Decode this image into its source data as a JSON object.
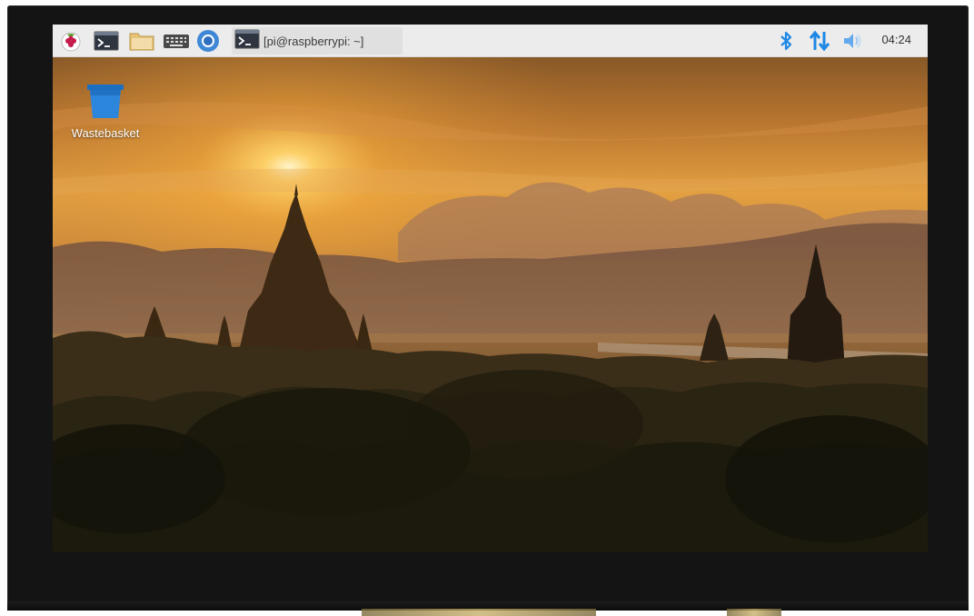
{
  "taskbar": {
    "launchers": [
      {
        "icon": "raspberry-menu-icon"
      },
      {
        "icon": "terminal-icon"
      },
      {
        "icon": "folder-icon"
      },
      {
        "icon": "keyboard-icon"
      },
      {
        "icon": "chromium-icon"
      }
    ],
    "window_task": {
      "icon": "terminal-icon",
      "label": "[pi@raspberrypi: ~]"
    },
    "tray": {
      "bluetooth_icon": "bluetooth-icon",
      "network_icon": "network-arrows-icon",
      "volume_icon": "volume-icon",
      "clock": "04:24"
    },
    "accent_color": "#1e88e5"
  },
  "desktop": {
    "icons": [
      {
        "icon": "wastebasket-icon",
        "label": "Wastebasket"
      }
    ],
    "wallpaper": "sunset-pagodas"
  }
}
